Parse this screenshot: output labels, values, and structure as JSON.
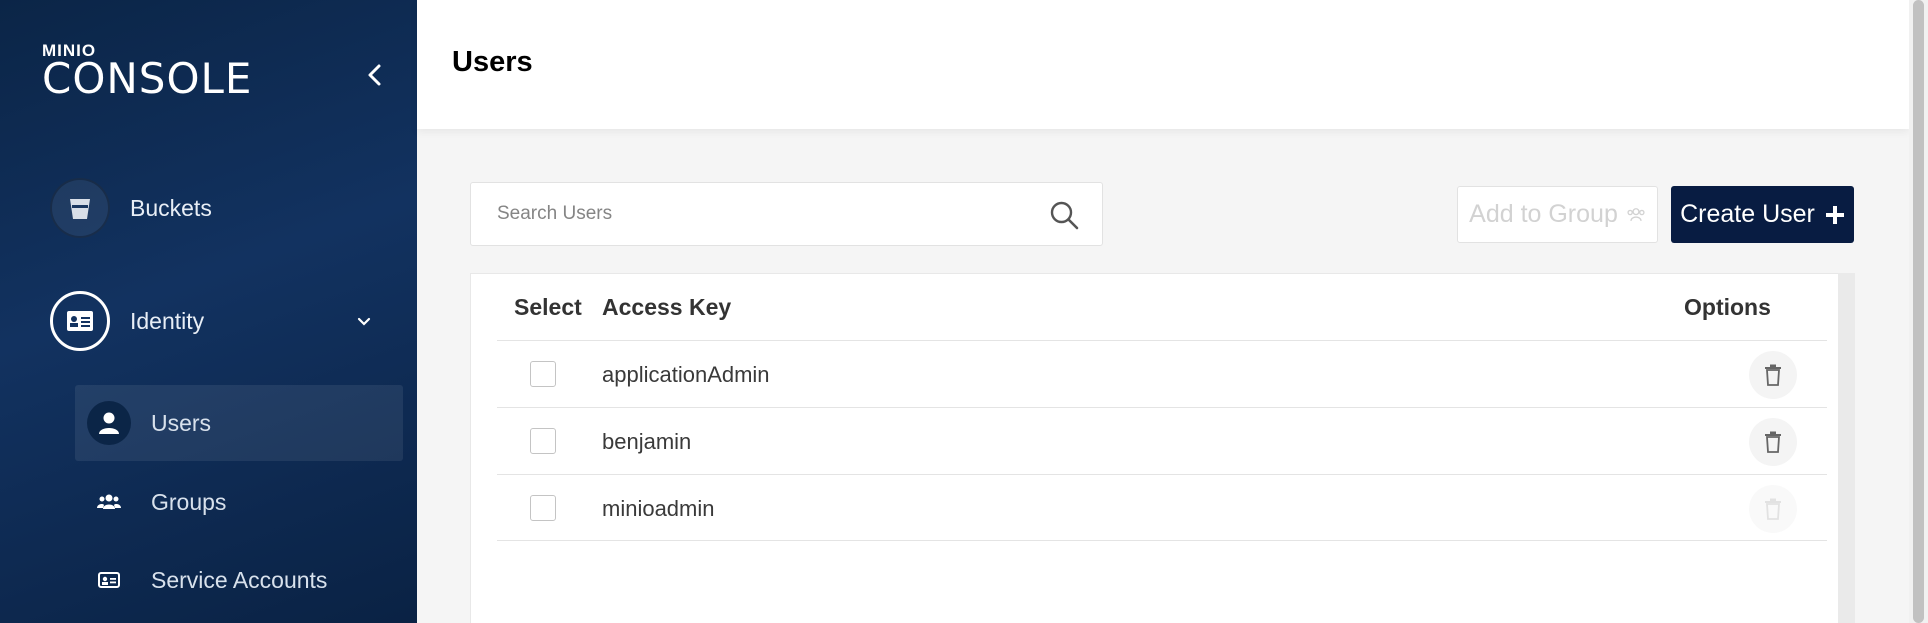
{
  "app": {
    "logo_small": "MINIO",
    "logo_big": "CONSOLE"
  },
  "sidebar": {
    "items": [
      {
        "label": "Buckets",
        "icon": "bucket-icon"
      },
      {
        "label": "Identity",
        "icon": "id-card-icon",
        "expanded": true
      }
    ],
    "subitems": [
      {
        "label": "Users",
        "icon": "user-icon",
        "active": true
      },
      {
        "label": "Groups",
        "icon": "groups-icon"
      },
      {
        "label": "Service Accounts",
        "icon": "service-account-icon"
      }
    ]
  },
  "header": {
    "title": "Users"
  },
  "search": {
    "placeholder": "Search Users",
    "value": ""
  },
  "toolbar": {
    "add_to_group_label": "Add to Group",
    "create_user_label": "Create User"
  },
  "table": {
    "columns": [
      "Select",
      "Access Key",
      "Options"
    ],
    "rows": [
      {
        "access_key": "applicationAdmin",
        "delete_enabled": true
      },
      {
        "access_key": "benjamin",
        "delete_enabled": true
      },
      {
        "access_key": "minioadmin",
        "delete_enabled": false
      }
    ]
  },
  "colors": {
    "sidebar_bg": "#0b2547",
    "primary_button": "#081c42"
  }
}
